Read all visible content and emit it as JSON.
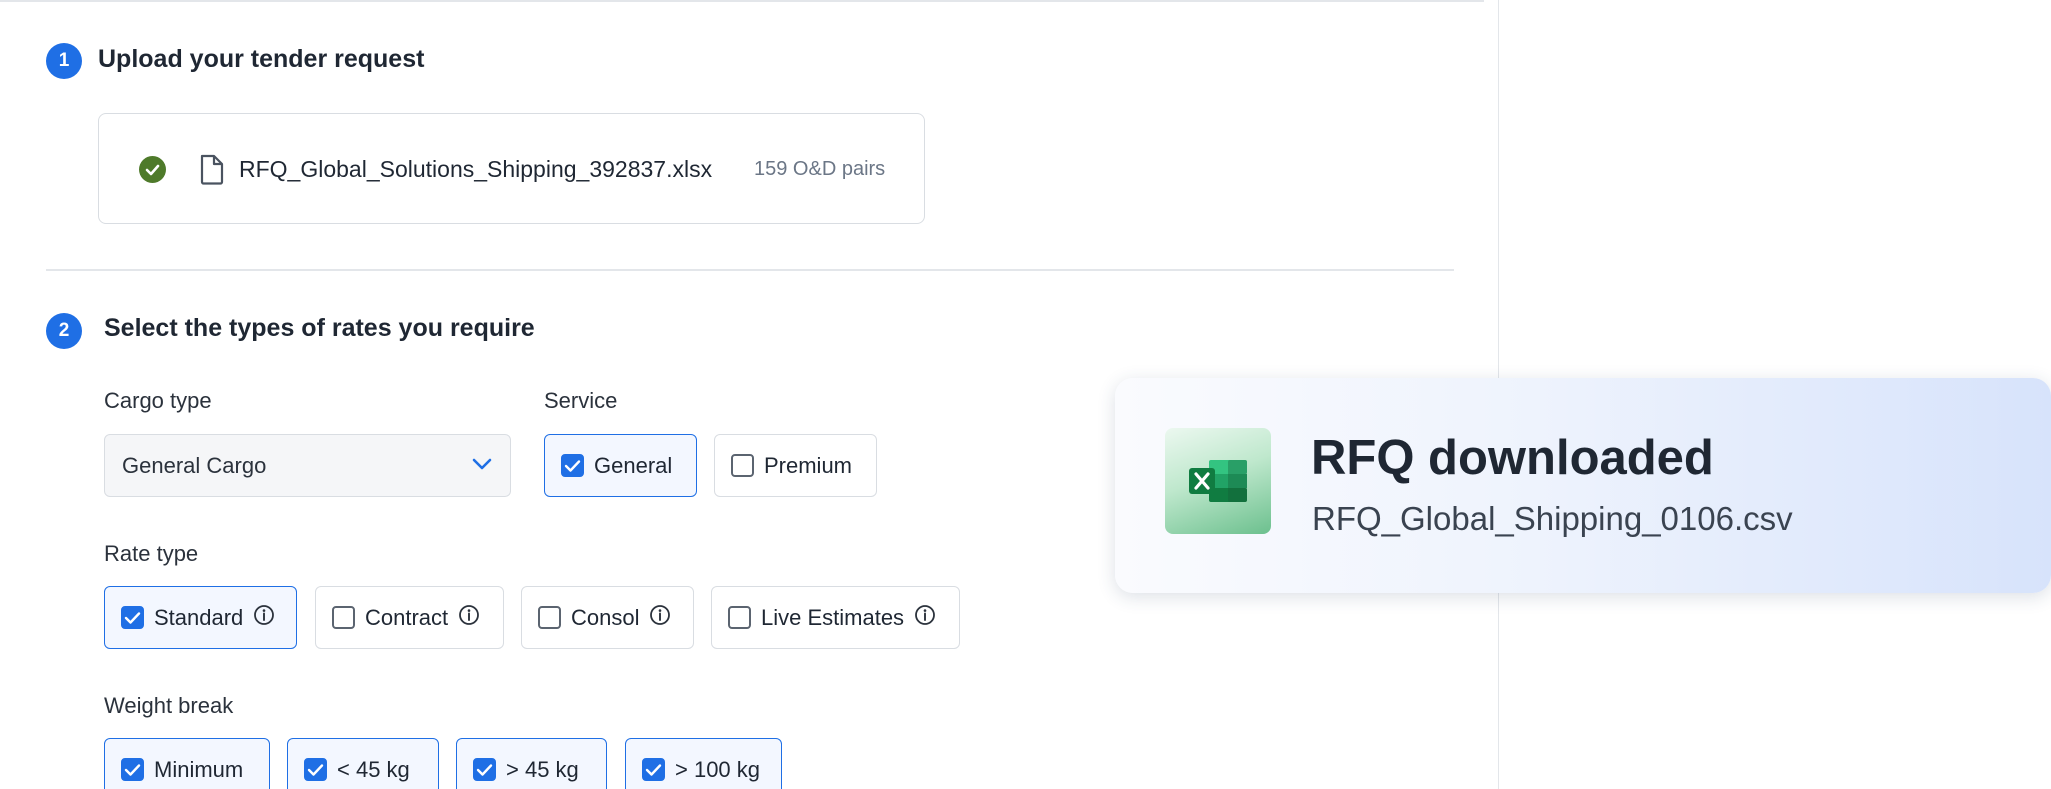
{
  "step1": {
    "number": "1",
    "title": "Upload your tender request",
    "file": {
      "name": "RFQ_Global_Solutions_Shipping_392837.xlsx",
      "pairs": "159 O&D pairs",
      "status_icon": "check-circle-icon",
      "file_icon": "document-icon"
    }
  },
  "step2": {
    "number": "2",
    "title": "Select the types of rates you require",
    "cargo_type": {
      "label": "Cargo type",
      "selected": "General Cargo"
    },
    "service": {
      "label": "Service",
      "options": [
        {
          "label": "General",
          "checked": true
        },
        {
          "label": "Premium",
          "checked": false
        }
      ]
    },
    "rate_type": {
      "label": "Rate type",
      "options": [
        {
          "label": "Standard",
          "checked": true
        },
        {
          "label": "Contract",
          "checked": false
        },
        {
          "label": "Consol",
          "checked": false
        },
        {
          "label": "Live Estimates",
          "checked": false
        }
      ]
    },
    "weight_break": {
      "label": "Weight break",
      "options": [
        {
          "label": "Minimum",
          "checked": true
        },
        {
          "label": "< 45 kg",
          "checked": true
        },
        {
          "label": "> 45 kg",
          "checked": true
        },
        {
          "label": "> 100 kg",
          "checked": true
        }
      ]
    }
  },
  "toast": {
    "title": "RFQ downloaded",
    "filename": "RFQ_Global_Shipping_0106.csv",
    "icon": "excel-icon"
  },
  "colors": {
    "accent": "#1f6fe5",
    "success": "#4e7a2a",
    "excel_green": "#1d7a45"
  }
}
